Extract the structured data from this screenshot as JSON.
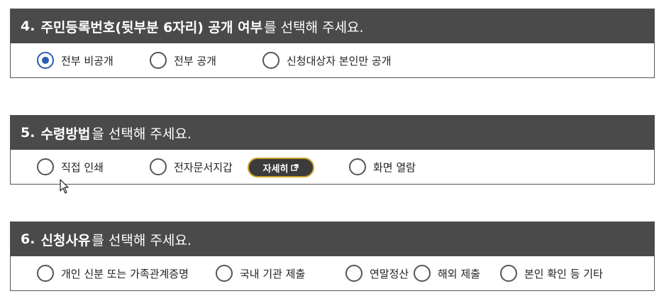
{
  "sections": [
    {
      "num": "4.",
      "title_bold": "주민등록번호(뒷부분 6자리) 공개 여부",
      "title_rest": "를 선택해 주세요.",
      "options": [
        {
          "label": "전부 비공개",
          "checked": true
        },
        {
          "label": "전부 공개",
          "checked": false
        },
        {
          "label": "신청대상자 본인만 공개",
          "checked": false
        }
      ]
    },
    {
      "num": "5.",
      "title_bold": "수령방법",
      "title_rest": "을 선택해 주세요.",
      "options": [
        {
          "label": "직접 인쇄",
          "checked": false
        },
        {
          "label": "전자문서지갑",
          "checked": false
        },
        {
          "label": "화면 열람",
          "checked": false
        }
      ],
      "detail_button": {
        "label": "자세히",
        "icon": "external-link-icon"
      }
    },
    {
      "num": "6.",
      "title_bold": "신청사유",
      "title_rest": "를 선택해 주세요.",
      "options": [
        {
          "label": "개인 신분 또는 가족관계증명",
          "checked": false
        },
        {
          "label": "국내 기관 제출",
          "checked": false
        },
        {
          "label": "연말정산",
          "checked": false
        },
        {
          "label": "해외 제출",
          "checked": false
        },
        {
          "label": "본인 확인 등 기타",
          "checked": false
        }
      ]
    }
  ],
  "colors": {
    "header_bg": "#4a4a4a",
    "radio_checked": "#2a5db0",
    "detail_border": "#c9a227"
  }
}
